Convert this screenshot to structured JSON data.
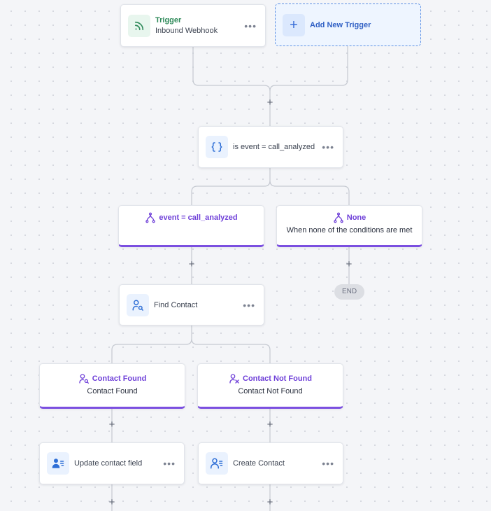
{
  "trigger": {
    "title": "Trigger",
    "subtitle": "Inbound Webhook",
    "icon": "rss-icon",
    "more": "•••"
  },
  "add_trigger": {
    "plus": "+",
    "label": "Add New Trigger"
  },
  "condition": {
    "label": "is event = call_analyzed",
    "icon": "braces-icon",
    "more": "•••"
  },
  "branches": {
    "branch_a": {
      "title": "event = call_analyzed",
      "subtitle": ""
    },
    "branch_none": {
      "title": "None",
      "subtitle": "When none of the conditions are met"
    },
    "contact_found": {
      "title": "Contact Found",
      "subtitle": "Contact Found"
    },
    "contact_not_found": {
      "title": "Contact Not Found",
      "subtitle": "Contact Not Found"
    }
  },
  "find_contact": {
    "label": "Find Contact",
    "icon": "user-search-icon",
    "more": "•••"
  },
  "update_contact": {
    "label": "Update contact field",
    "icon": "user-list-icon",
    "more": "•••"
  },
  "create_contact": {
    "label": "Create Contact",
    "icon": "user-list-outline-icon",
    "more": "•••"
  },
  "end": {
    "label": "END"
  },
  "plus_symbol": "+",
  "colors": {
    "branch_accent": "#7b4fe0",
    "trigger_green": "#2f8a5a",
    "action_blue": "#2f6fd6",
    "add_trigger_bg": "#eef5ff"
  }
}
